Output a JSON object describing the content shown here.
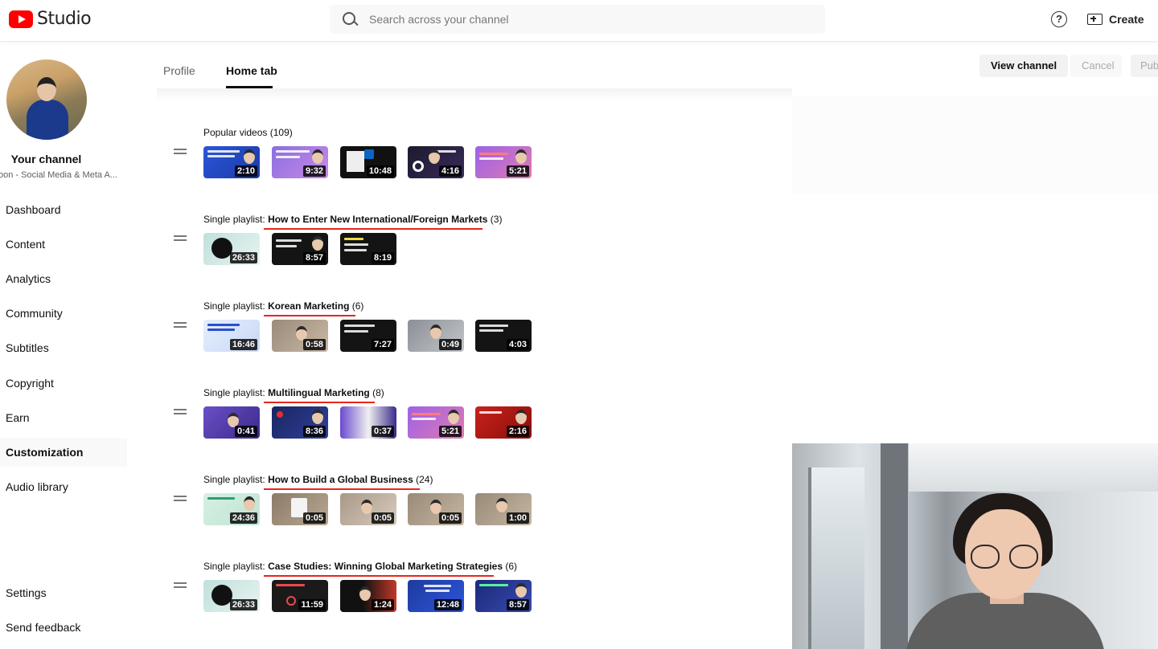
{
  "app": {
    "logo_text": "Studio"
  },
  "search": {
    "placeholder": "Search across your channel"
  },
  "header": {
    "help_label": "?",
    "create_label": "Create"
  },
  "sidebar": {
    "title": "Your channel",
    "subtitle": "oon - Social Media & Meta A...",
    "items": [
      {
        "label": "Dashboard"
      },
      {
        "label": "Content"
      },
      {
        "label": "Analytics"
      },
      {
        "label": "Community"
      },
      {
        "label": "Subtitles"
      },
      {
        "label": "Copyright"
      },
      {
        "label": "Earn"
      },
      {
        "label": "Customization",
        "active": true
      },
      {
        "label": "Audio library"
      },
      {
        "label": "Settings"
      },
      {
        "label": "Send feedback"
      }
    ]
  },
  "tabs": [
    {
      "label": "Profile"
    },
    {
      "label": "Home tab",
      "active": true
    }
  ],
  "actions": {
    "view_channel": "View channel",
    "cancel": "Cancel",
    "publish": "Pub"
  },
  "sections": [
    {
      "prefix": "Popular videos",
      "name": "",
      "count": "(109)",
      "thumbs": [
        {
          "duration": "2:10"
        },
        {
          "duration": "9:32"
        },
        {
          "duration": "10:48"
        },
        {
          "duration": "4:16"
        },
        {
          "duration": "5:21"
        }
      ]
    },
    {
      "prefix": "Single playlist:",
      "name": "How to Enter New International/Foreign Markets",
      "count": "(3)",
      "thumbs": [
        {
          "duration": "26:33"
        },
        {
          "duration": "8:57"
        },
        {
          "duration": "8:19"
        }
      ]
    },
    {
      "prefix": "Single playlist:",
      "name": "Korean Marketing",
      "count": "(6)",
      "thumbs": [
        {
          "duration": "16:46"
        },
        {
          "duration": "0:58"
        },
        {
          "duration": "7:27"
        },
        {
          "duration": "0:49"
        },
        {
          "duration": "4:03"
        }
      ]
    },
    {
      "prefix": "Single playlist:",
      "name": "Multilingual Marketing",
      "count": "(8)",
      "thumbs": [
        {
          "duration": "0:41"
        },
        {
          "duration": "8:36"
        },
        {
          "duration": "0:37"
        },
        {
          "duration": "5:21"
        },
        {
          "duration": "2:16"
        }
      ]
    },
    {
      "prefix": "Single playlist:",
      "name": "How to Build a Global Business",
      "count": "(24)",
      "thumbs": [
        {
          "duration": "24:36"
        },
        {
          "duration": "0:05"
        },
        {
          "duration": "0:05"
        },
        {
          "duration": "0:05"
        },
        {
          "duration": "1:00"
        }
      ]
    },
    {
      "prefix": "Single playlist:",
      "name": "Case Studies: Winning Global Marketing Strategies",
      "count": "(6)",
      "thumbs": [
        {
          "duration": "26:33"
        },
        {
          "duration": "11:59"
        },
        {
          "duration": "1:24"
        },
        {
          "duration": "12:48"
        },
        {
          "duration": "8:57"
        }
      ]
    }
  ],
  "colors": {
    "brand_red": "#ff0000",
    "underline_red": "#e8261c"
  }
}
